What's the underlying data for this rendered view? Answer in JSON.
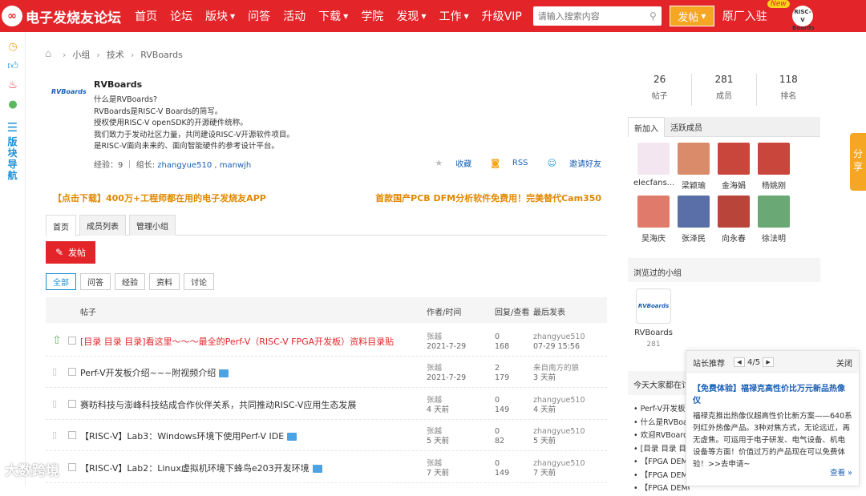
{
  "topbar": {
    "logo_text": "电子发烧友论坛",
    "nav": [
      {
        "label": "首页",
        "caret": false
      },
      {
        "label": "论坛",
        "caret": false
      },
      {
        "label": "版块",
        "caret": true
      },
      {
        "label": "问答",
        "caret": false
      },
      {
        "label": "活动",
        "caret": false
      },
      {
        "label": "下载",
        "caret": true
      },
      {
        "label": "学院",
        "caret": false
      },
      {
        "label": "发现",
        "caret": true
      },
      {
        "label": "工作",
        "caret": true
      },
      {
        "label": "升级VIP",
        "caret": false
      }
    ],
    "search_placeholder": "请输入搜索内容",
    "post_button": "发帖",
    "factory": "原厂入驻",
    "new_badge": "New",
    "avatar_text_1": "RISC-V",
    "avatar_text_2": "Boards"
  },
  "rail": {
    "nav_text": [
      "版",
      "块",
      "导",
      "航"
    ]
  },
  "breadcrumb": [
    "小组",
    "技术",
    "RVBoards"
  ],
  "group": {
    "logo": "RVBoards",
    "name": "RVBoards",
    "desc": [
      "什么是RVBoards?",
      "RVBoards是RISC-V Boards的简写。",
      "授权使用RISC-V openSDK的开源硬件统称。",
      "我们致力于发动社区力量，共同建设RISC-V开源软件项目。",
      "是RISC-V面向未来的、面向智能硬件的参考设计平台。"
    ],
    "meta_prefix": "经验：9 ｜ 组长: ",
    "leader1": "zhangyue510",
    "leader_sep": " , ",
    "leader2": "manwjh",
    "actions": {
      "fav": "收藏",
      "rss": "RSS",
      "invite": "邀请好友"
    }
  },
  "promo": {
    "left": "【点击下载】400万+工程师都在用的电子发烧友APP",
    "right": "首款国产PCB DFM分析软件免费用！完美替代Cam350"
  },
  "tabs": [
    "首页",
    "成员列表",
    "管理小组"
  ],
  "new_post": "发帖",
  "filters": [
    "全部",
    "问答",
    "经验",
    "资料",
    "讨论"
  ],
  "thead": {
    "thread": "帖子",
    "author": "作者/时间",
    "reply": "回复/查看",
    "last": "最后发表"
  },
  "threads": [
    {
      "title": "[目录 目录 目录]看这里～～～最全的Perf-V（RISC-V FPGA开发板）资料目录贴",
      "red": true,
      "img": false,
      "top": true,
      "author": "张越",
      "time": "2021-7-29",
      "replies": "0",
      "views": "168",
      "last_user": "zhangyue510",
      "last_time": "07-29 15:56"
    },
    {
      "title": "Perf-V开发板介绍~~~附视频介绍",
      "red": false,
      "img": true,
      "top": false,
      "author": "张越",
      "time": "2021-7-29",
      "replies": "2",
      "views": "179",
      "last_user": "来自南方的狼",
      "last_time": "3 天前"
    },
    {
      "title": "赛昉科技与澎峰科技结成合作伙伴关系，共同推动RISC-V应用生态发展",
      "red": false,
      "img": false,
      "top": false,
      "author": "张越",
      "time": "4 天前",
      "replies": "0",
      "views": "149",
      "last_user": "zhangyue510",
      "last_time": "4 天前"
    },
    {
      "title": "【RISC-V】Lab3：Windows环境下使用Perf-V IDE",
      "red": false,
      "img": true,
      "top": false,
      "author": "张越",
      "time": "5 天前",
      "replies": "0",
      "views": "82",
      "last_user": "zhangyue510",
      "last_time": "5 天前"
    },
    {
      "title": "【RISC-V】Lab2：Linux虚拟机环境下蜂鸟e203开发环境",
      "red": false,
      "img": true,
      "top": false,
      "author": "张越",
      "time": "7 天前",
      "replies": "0",
      "views": "149",
      "last_user": "zhangyue510",
      "last_time": "7 天前"
    }
  ],
  "stats": [
    {
      "num": "26",
      "label": "帖子"
    },
    {
      "num": "281",
      "label": "成员"
    },
    {
      "num": "118",
      "label": "排名"
    }
  ],
  "side_tabs": [
    "新加入",
    "活跃成员"
  ],
  "members": [
    {
      "name": "elecfans...",
      "color": "#f3e6f0"
    },
    {
      "name": "梁颖瑜",
      "color": "#d98b6a"
    },
    {
      "name": "金海娟",
      "color": "#c9463d"
    },
    {
      "name": "杨姚刚",
      "color": "#c9463d"
    },
    {
      "name": "吴海庆",
      "color": "#e07a6a"
    },
    {
      "name": "张泽民",
      "color": "#5a6fa8"
    },
    {
      "name": "向永春",
      "color": "#b8443a"
    },
    {
      "name": "徐法明",
      "color": "#6aa876"
    }
  ],
  "visited": {
    "title": "浏览过的小组",
    "name": "RVBoards",
    "count": "281",
    "logo": "RVBoards"
  },
  "today": {
    "title": "今天大家都在讨论",
    "items": [
      "• Perf-V开发板",
      "• 什么是RVBoa",
      "• 欢迎RVBoards",
      "• [目录 目录 目",
      "• 【FPGA DEMO",
      "• 【FPGA DEMO",
      "• 【FPGA DEMO"
    ]
  },
  "share": [
    "分",
    "享"
  ],
  "popup": {
    "head": "站长推荐",
    "pager": "4/5",
    "close": "关闭",
    "title": "【免费体验】福禄克高性价比万元新品热像仪",
    "body": "福禄克推出热像仪超高性价比新方案——640系列红外热像产品。3种对焦方式，无论远近，再无虚焦。可运用于电子研发、电气设备、机电设备等方面！价值过万的产品现在可以免费体验！>>去申请~",
    "more": "查看 »"
  },
  "watermark": "大数跨境"
}
